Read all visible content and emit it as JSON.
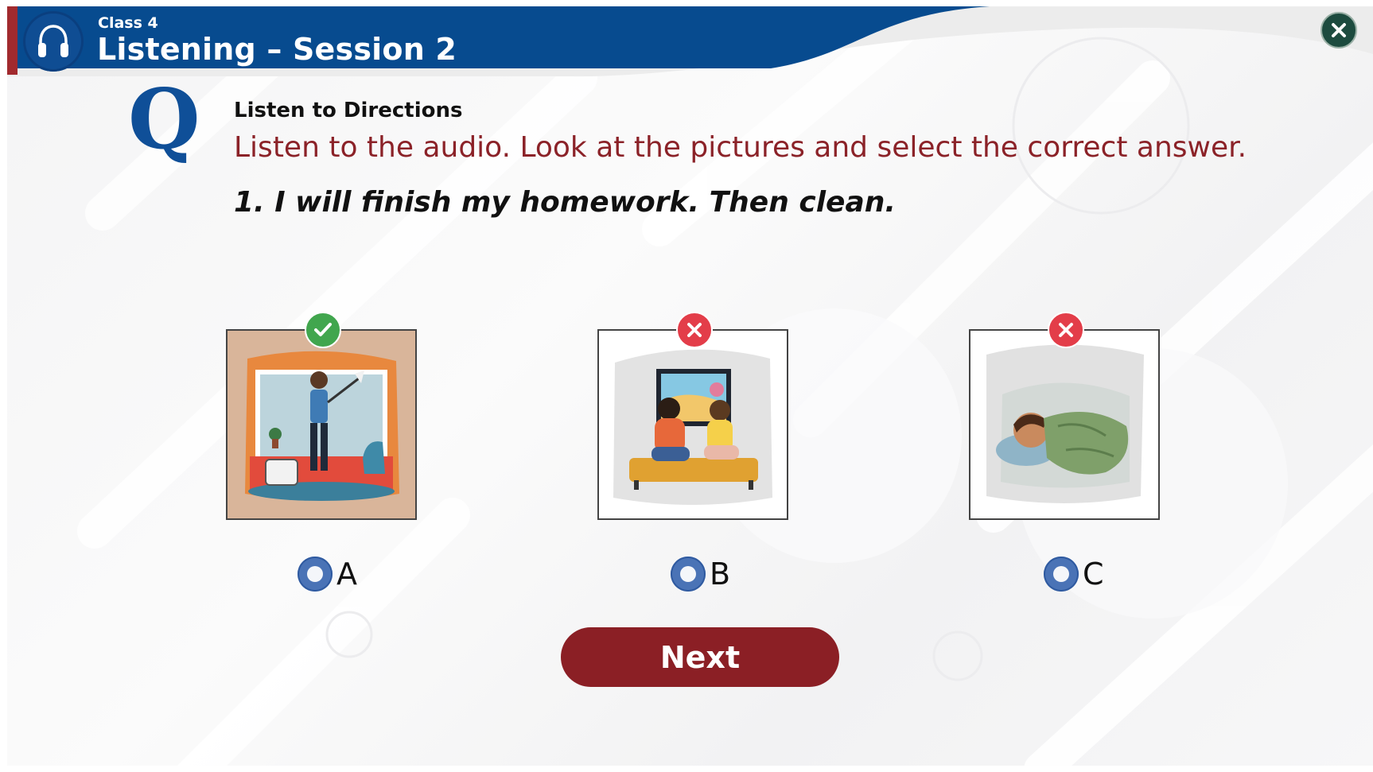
{
  "header": {
    "class_label": "Class 4",
    "title": "Listening – Session 2",
    "logo_icon": "headphones-icon",
    "close_icon": "close-icon",
    "colors": {
      "banner": "#074b8f",
      "accent": "#a12a2e",
      "close_bg": "#1d4b3f"
    }
  },
  "question": {
    "q_letter": "Q",
    "directions_label": "Listen to Directions",
    "instruction": "Listen to the audio. Look at the pictures and select the correct answer.",
    "prompt": "1. I will finish my homework. Then clean."
  },
  "options": [
    {
      "letter": "A",
      "picture": "person-cleaning-room",
      "status": "correct",
      "status_icon": "check-icon"
    },
    {
      "letter": "B",
      "picture": "kids-watching-tv",
      "status": "incorrect",
      "status_icon": "close-icon"
    },
    {
      "letter": "C",
      "picture": "child-sleeping",
      "status": "incorrect",
      "status_icon": "close-icon"
    }
  ],
  "actions": {
    "next_label": "Next",
    "next_color": "#8b1f25"
  }
}
